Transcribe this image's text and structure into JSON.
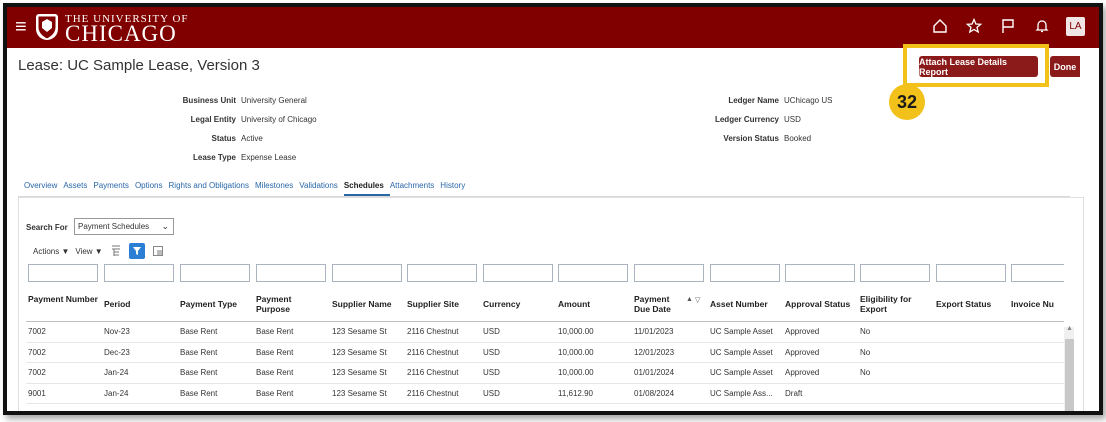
{
  "header": {
    "university_top": "THE UNIVERSITY OF",
    "university_name": "CHICAGO",
    "avatar_initials": "LA",
    "icons": [
      "menu-icon",
      "home-icon",
      "star-icon",
      "flag-icon",
      "bell-icon"
    ]
  },
  "page": {
    "title": "Lease: UC Sample Lease, Version 3",
    "attach_button": "Attach Lease Details Report",
    "done_button": "Done",
    "step_number": "32"
  },
  "details_left": [
    {
      "label": "Business Unit",
      "value": "University General"
    },
    {
      "label": "Legal Entity",
      "value": "University of Chicago"
    },
    {
      "label": "Status",
      "value": "Active"
    },
    {
      "label": "Lease Type",
      "value": "Expense Lease"
    }
  ],
  "details_right": [
    {
      "label": "Ledger Name",
      "value": "UChicago US"
    },
    {
      "label": "Ledger Currency",
      "value": "USD"
    },
    {
      "label": "Version Status",
      "value": "Booked"
    }
  ],
  "tabs": [
    {
      "label": "Overview",
      "active": false
    },
    {
      "label": "Assets",
      "active": false
    },
    {
      "label": "Payments",
      "active": false
    },
    {
      "label": "Options",
      "active": false
    },
    {
      "label": "Rights and Obligations",
      "active": false
    },
    {
      "label": "Milestones",
      "active": false
    },
    {
      "label": "Validations",
      "active": false
    },
    {
      "label": "Schedules",
      "active": true
    },
    {
      "label": "Attachments",
      "active": false
    },
    {
      "label": "History",
      "active": false
    }
  ],
  "search": {
    "label": "Search For",
    "selected": "Payment Schedules"
  },
  "toolbar": {
    "actions": "Actions",
    "view": "View"
  },
  "table": {
    "columns": [
      "Payment Number",
      "Period",
      "Payment Type",
      "Payment Purpose",
      "Supplier Name",
      "Supplier Site",
      "Currency",
      "Amount",
      "Payment Due Date",
      "Asset Number",
      "Approval Status",
      "Eligibility for Export",
      "Export Status",
      "Invoice Nu"
    ],
    "rows": [
      [
        "7002",
        "Nov-23",
        "Base Rent",
        "Base Rent",
        "123 Sesame St",
        "2116 Chestnut",
        "USD",
        "10,000.00",
        "11/01/2023",
        "UC Sample Asset",
        "Approved",
        "No",
        "",
        ""
      ],
      [
        "7002",
        "Dec-23",
        "Base Rent",
        "Base Rent",
        "123 Sesame St",
        "2116 Chestnut",
        "USD",
        "10,000.00",
        "12/01/2023",
        "UC Sample Asset",
        "Approved",
        "No",
        "",
        ""
      ],
      [
        "7002",
        "Jan-24",
        "Base Rent",
        "Base Rent",
        "123 Sesame St",
        "2116 Chestnut",
        "USD",
        "10,000.00",
        "01/01/2024",
        "UC Sample Asset",
        "Approved",
        "No",
        "",
        ""
      ],
      [
        "9001",
        "Jan-24",
        "Base Rent",
        "Base Rent",
        "123 Sesame St",
        "2116 Chestnut",
        "USD",
        "11,612.90",
        "01/08/2024",
        "UC Sample Ass...",
        "Draft",
        "",
        "",
        ""
      ]
    ]
  },
  "colors": {
    "brand": "#800000",
    "button": "#8b1a1a",
    "highlight": "#f2c21b",
    "link": "#2a67a8"
  }
}
